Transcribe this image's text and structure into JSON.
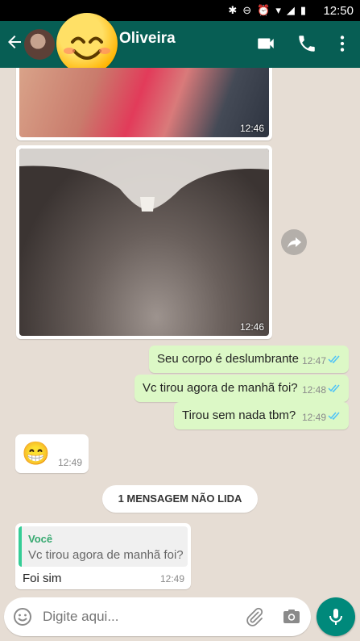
{
  "status_bar": {
    "time": "12:50"
  },
  "header": {
    "contact_name": "Oliveira"
  },
  "messages": [
    {
      "type": "image",
      "time": "12:46"
    },
    {
      "type": "image",
      "time": "12:46"
    },
    {
      "type": "text",
      "direction": "out",
      "text": "Seu corpo é deslumbrante",
      "time": "12:47",
      "status": "read"
    },
    {
      "type": "text",
      "direction": "out",
      "text": "Vc tirou agora de manhã foi?",
      "time": "12:48",
      "status": "read"
    },
    {
      "type": "text",
      "direction": "out",
      "text": "Tirou sem nada tbm?",
      "time": "12:49",
      "status": "read"
    },
    {
      "type": "emoji",
      "direction": "in",
      "text": "😁",
      "time": "12:49"
    }
  ],
  "unread_divider": "1 MENSAGEM NÃO LIDA",
  "reply": {
    "quoted_author": "Você",
    "quoted_text": "Vc tirou agora de manhã foi?",
    "text": "Foi sim",
    "time": "12:49"
  },
  "composer": {
    "placeholder": "Digite aqui..."
  },
  "colors": {
    "header": "#075e54",
    "outgoing_bubble": "#dcf8c6",
    "read_ticks": "#4fc3f7",
    "mic_button": "#00897b"
  }
}
